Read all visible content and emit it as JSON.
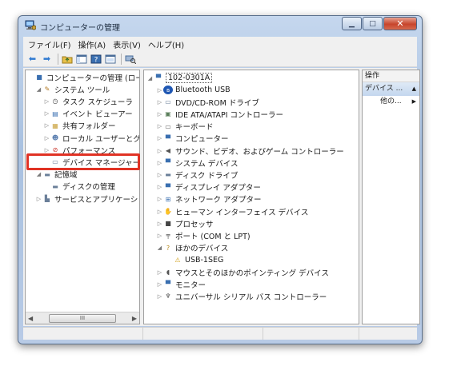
{
  "window": {
    "title": "コンピューターの管理",
    "icon": "computer-management-icon",
    "caption_buttons": [
      "minimize",
      "maximize",
      "close"
    ]
  },
  "menubar": {
    "items": [
      "ファイル(F)",
      "操作(A)",
      "表示(V)",
      "ヘルプ(H)"
    ]
  },
  "toolbar": {
    "buttons": [
      "back-icon",
      "forward-icon",
      "up-folder-icon",
      "show-hide-tree-icon",
      "help-icon",
      "properties-icon",
      "scan-hardware-icon"
    ]
  },
  "left_tree": {
    "items": [
      {
        "label": "コンピューターの管理 (ローカ",
        "icon": "computer-management-icon",
        "level": 0,
        "arrow": ""
      },
      {
        "label": "システム ツール",
        "icon": "tools-icon",
        "level": 1,
        "arrow": "◢"
      },
      {
        "label": "タスク スケジューラ",
        "icon": "clock-icon",
        "level": 2,
        "arrow": "▷"
      },
      {
        "label": "イベント ビューアー",
        "icon": "event-viewer-icon",
        "level": 2,
        "arrow": "▷"
      },
      {
        "label": "共有フォルダー",
        "icon": "shared-folder-icon",
        "level": 2,
        "arrow": "▷"
      },
      {
        "label": "ローカル ユーザーとグ",
        "icon": "users-icon",
        "level": 2,
        "arrow": "▷"
      },
      {
        "label": "パフォーマンス",
        "icon": "performance-icon",
        "level": 2,
        "arrow": "▷"
      },
      {
        "label": "デバイス マネージャー",
        "icon": "device-manager-icon",
        "level": 2,
        "arrow": ""
      },
      {
        "label": "記憶域",
        "icon": "storage-icon",
        "level": 1,
        "arrow": "◢"
      },
      {
        "label": "ディスクの管理",
        "icon": "disk-management-icon",
        "level": 2,
        "arrow": ""
      },
      {
        "label": "サービスとアプリケーショ",
        "icon": "services-icon",
        "level": 1,
        "arrow": "▷"
      }
    ],
    "scrollbar_thumb": "III"
  },
  "device_tree": {
    "root": "102-0301A",
    "items": [
      {
        "label": "Bluetooth USB",
        "icon": "bluetooth-icon",
        "level": 1,
        "arrow": "▷"
      },
      {
        "label": "DVD/CD-ROM ドライブ",
        "icon": "dvd-drive-icon",
        "level": 1,
        "arrow": "▷"
      },
      {
        "label": "IDE ATA/ATAPI コントローラー",
        "icon": "ide-controller-icon",
        "level": 1,
        "arrow": "▷"
      },
      {
        "label": "キーボード",
        "icon": "keyboard-icon",
        "level": 1,
        "arrow": "▷"
      },
      {
        "label": "コンピューター",
        "icon": "computer-icon",
        "level": 1,
        "arrow": "▷"
      },
      {
        "label": "サウンド、ビデオ、およびゲーム コントローラー",
        "icon": "sound-icon",
        "level": 1,
        "arrow": "▷"
      },
      {
        "label": "システム デバイス",
        "icon": "system-device-icon",
        "level": 1,
        "arrow": "▷"
      },
      {
        "label": "ディスク ドライブ",
        "icon": "disk-drive-icon",
        "level": 1,
        "arrow": "▷"
      },
      {
        "label": "ディスプレイ アダプター",
        "icon": "display-adapter-icon",
        "level": 1,
        "arrow": "▷"
      },
      {
        "label": "ネットワーク アダプター",
        "icon": "network-adapter-icon",
        "level": 1,
        "arrow": "▷"
      },
      {
        "label": "ヒューマン インターフェイス デバイス",
        "icon": "hid-icon",
        "level": 1,
        "arrow": "▷"
      },
      {
        "label": "プロセッサ",
        "icon": "processor-icon",
        "level": 1,
        "arrow": "▷"
      },
      {
        "label": "ポート (COM と LPT)",
        "icon": "port-icon",
        "level": 1,
        "arrow": "▷"
      },
      {
        "label": "ほかのデバイス",
        "icon": "other-devices-icon",
        "level": 1,
        "arrow": "◢"
      },
      {
        "label": "USB-1SEG",
        "icon": "unknown-device-warning-icon",
        "level": 2,
        "arrow": ""
      },
      {
        "label": "マウスとそのほかのポインティング デバイス",
        "icon": "mouse-icon",
        "level": 1,
        "arrow": "▷"
      },
      {
        "label": "モニター",
        "icon": "monitor-icon",
        "level": 1,
        "arrow": "▷"
      },
      {
        "label": "ユニバーサル シリアル バス コントローラー",
        "icon": "usb-controller-icon",
        "level": 1,
        "arrow": "▷"
      }
    ]
  },
  "actions": {
    "header": "操作",
    "section": "デバイス ...",
    "section_arrow": "▲",
    "item": "他の...",
    "item_arrow": "▶"
  },
  "highlight": {
    "target": "デバイス マネージャー",
    "color": "#e03224"
  }
}
